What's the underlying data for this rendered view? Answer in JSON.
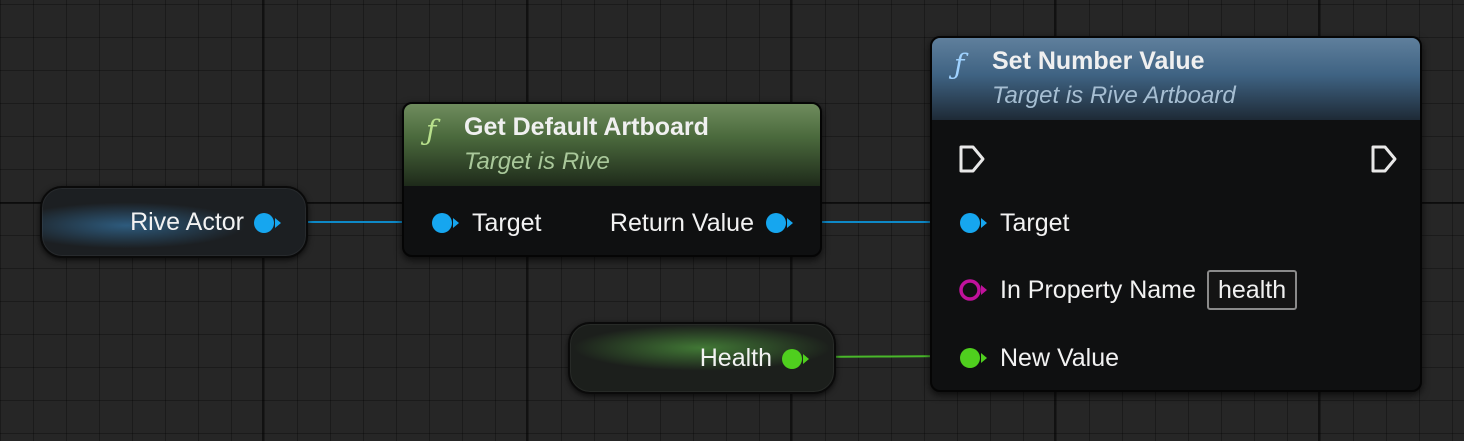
{
  "graph": {
    "rive_actor": {
      "label": "Rive Actor"
    },
    "health": {
      "label": "Health"
    },
    "get_default_artboard": {
      "title": "Get Default Artboard",
      "subtitle": "Target is Rive",
      "input_pin": "Target",
      "output_pin": "Return Value"
    },
    "set_number_value": {
      "title": "Set Number Value",
      "subtitle": "Target is Rive Artboard",
      "target_pin": "Target",
      "property_name_pin": "In Property Name",
      "property_name_value": "health",
      "new_value_pin": "New Value"
    },
    "function_icon": "ƒ",
    "icons": [
      "function-icon",
      "exec-pin-icon",
      "object-pin-icon",
      "name-pin-icon",
      "float-pin-icon"
    ]
  },
  "colors": {
    "background": "#262626",
    "object_pin": "#16a6ef",
    "float_pin": "#4fcf1e",
    "name_pin": "#c0119c",
    "object_wire": "#0e89c7",
    "float_wire": "#49b82a",
    "pure_header": "#5b7a4a",
    "callable_header": "#3f6383"
  }
}
